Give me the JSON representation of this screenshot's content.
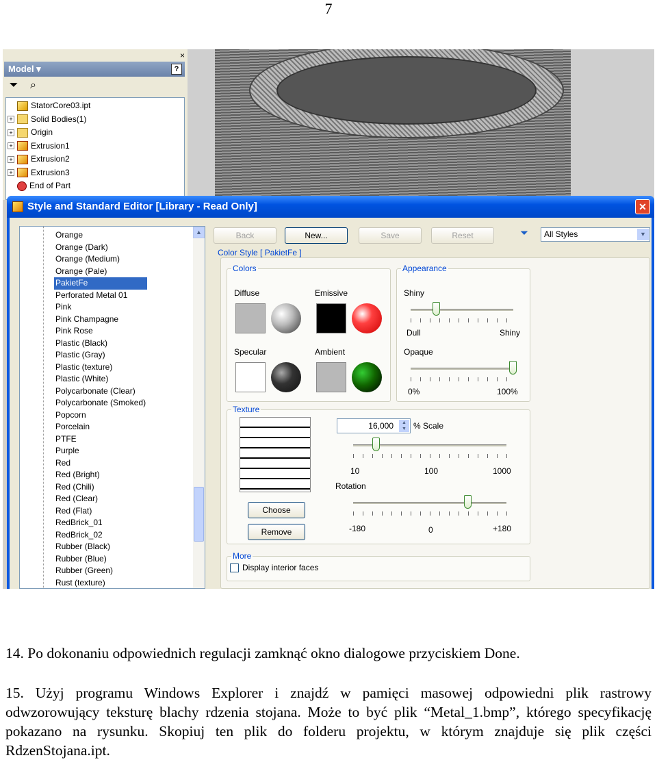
{
  "page_number": "7",
  "model_panel": {
    "close": "×",
    "title": "Model ▾",
    "help": "?",
    "tree": [
      {
        "label": "StatorCore03.ipt",
        "icon": "part-icon",
        "expander": ""
      },
      {
        "label": "Solid Bodies(1)",
        "icon": "folder-icon",
        "expander": "+"
      },
      {
        "label": "Origin",
        "icon": "folder-icon",
        "expander": "+"
      },
      {
        "label": "Extrusion1",
        "icon": "extrusion-icon",
        "expander": "+"
      },
      {
        "label": "Extrusion2",
        "icon": "extrusion-icon",
        "expander": "+"
      },
      {
        "label": "Extrusion3",
        "icon": "extrusion-icon",
        "expander": "+"
      },
      {
        "label": "End of Part",
        "icon": "end-of-part-icon",
        "expander": ""
      }
    ]
  },
  "dialog": {
    "title": "Style and Standard Editor [Library - Read Only]",
    "close": "✕",
    "buttons": {
      "back": "Back",
      "new": "New...",
      "save": "Save",
      "reset": "Reset"
    },
    "filter_value": "All Styles",
    "styles": [
      "Orange",
      "Orange (Dark)",
      "Orange (Medium)",
      "Orange (Pale)",
      "PakietFe",
      "Perforated Metal 01",
      "Pink",
      "Pink Champagne",
      "Pink Rose",
      "Plastic (Black)",
      "Plastic (Gray)",
      "Plastic (texture)",
      "Plastic (White)",
      "Polycarbonate (Clear)",
      "Polycarbonate (Smoked)",
      "Popcorn",
      "Porcelain",
      "PTFE",
      "Purple",
      "Red",
      "Red (Bright)",
      "Red (Chili)",
      "Red (Clear)",
      "Red (Flat)",
      "RedBrick_01",
      "RedBrick_02",
      "Rubber (Black)",
      "Rubber (Blue)",
      "Rubber (Green)",
      "Rust (texture)"
    ],
    "selected_style": "PakietFe",
    "color_style_label": "Color Style [ PakietFe ]",
    "colors": {
      "legend": "Colors",
      "diffuse": "Diffuse",
      "emissive": "Emissive",
      "specular": "Specular",
      "ambient": "Ambient"
    },
    "appearance": {
      "legend": "Appearance",
      "shiny": "Shiny",
      "dull": "Dull",
      "shiny_end": "Shiny",
      "opaque": "Opaque",
      "min": "0%",
      "max": "100%",
      "shininess": 0.25,
      "opacity": 1.0
    },
    "texture": {
      "legend": "Texture",
      "scale_value": "16,000",
      "scale_label": "% Scale",
      "scale_ticks": [
        "10",
        "100",
        "1000"
      ],
      "rotation_label": "Rotation",
      "rotation_ticks": [
        "-180",
        "0",
        "+180"
      ],
      "choose": "Choose",
      "remove": "Remove",
      "rotation_value": 0.75,
      "scale_position": 0.15
    },
    "more": {
      "legend": "More",
      "display_interior_faces": "Display interior faces"
    }
  },
  "text": {
    "para_14": "14. Po dokonaniu odpowiednich regulacji zamknąć okno dialogowe przyciskiem Done.",
    "para_15": "15. Użyj programu Windows Explorer i znajdź w pamięci masowej odpowiedni plik rastrowy odwzorowujący teksturę blachy rdzenia stojana. Może to być plik “Metal_1.bmp”, którego specyfikację pokazano na rysunku. Skopiuj ten plik do folderu projektu, w którym znajduje się plik części RdzenStojana.ipt."
  }
}
